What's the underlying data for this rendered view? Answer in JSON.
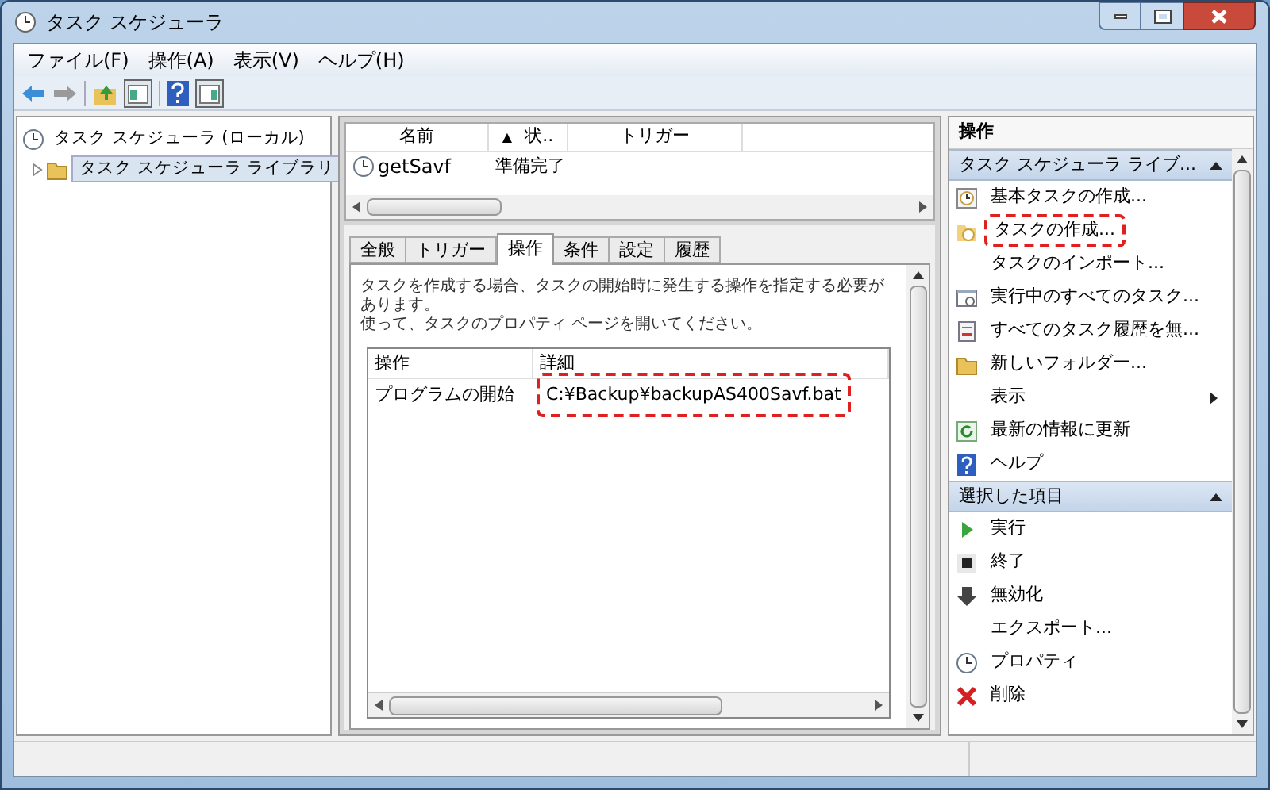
{
  "window": {
    "title": "タスク スケジューラ"
  },
  "menu": [
    "ファイル(F)",
    "操作(A)",
    "表示(V)",
    "ヘルプ(H)"
  ],
  "tree": [
    {
      "label": "タスク スケジューラ (ローカル)",
      "selected": false,
      "kind": "clock",
      "children": [
        {
          "label": "タスク スケジューラ ライブラリ",
          "selected": true,
          "kind": "folder",
          "expanded": false
        }
      ]
    }
  ],
  "task_list": {
    "columns": [
      {
        "label": "名前"
      },
      {
        "label": "状..",
        "sort": "▲"
      },
      {
        "label": "トリガー"
      }
    ],
    "rows": [
      {
        "name": "getSavf",
        "status": "準備完了",
        "selected": false
      }
    ]
  },
  "tabs": [
    {
      "label": "全般",
      "selected": false
    },
    {
      "label": "トリガー",
      "selected": false
    },
    {
      "label": "操作",
      "selected": true
    },
    {
      "label": "条件",
      "selected": false
    },
    {
      "label": "設定",
      "selected": false
    },
    {
      "label": "履歴",
      "selected": false
    }
  ],
  "description": [
    "タスクを作成する場合、タスクの開始時に発生する操作を指定する必要があります。",
    "使って、タスクのプロパティ ページを開いてください。"
  ],
  "actions_table": {
    "columns": [
      "操作",
      "詳細"
    ],
    "rows": [
      {
        "action": "プログラムの開始",
        "detail": "C:¥Backup¥backupAS400Savf.bat",
        "highlighted": true
      }
    ]
  },
  "actions_pane": {
    "title": "操作",
    "sections": [
      {
        "title": "タスク スケジューラ ライブ...",
        "expanded": true,
        "items": [
          {
            "label": "基本タスクの作成...",
            "kind": "wizard",
            "highlighted": false
          },
          {
            "label": "タスクの作成...",
            "kind": "task",
            "highlighted": true
          },
          {
            "label": "タスクのインポート...",
            "kind": "plain",
            "highlighted": false
          },
          {
            "label": "実行中のすべてのタスク...",
            "kind": "window",
            "highlighted": false
          },
          {
            "label": "すべてのタスク履歴を無...",
            "kind": "history",
            "highlighted": false
          },
          {
            "label": "新しいフォルダー...",
            "kind": "folder",
            "highlighted": false
          },
          {
            "label": "表示",
            "kind": "plain",
            "highlighted": false,
            "submenu": true
          },
          {
            "label": "最新の情報に更新",
            "kind": "refresh",
            "highlighted": false
          },
          {
            "label": "ヘルプ",
            "kind": "help",
            "highlighted": false
          }
        ]
      },
      {
        "title": "選択した項目",
        "expanded": true,
        "items": [
          {
            "label": "実行",
            "kind": "run",
            "highlighted": false
          },
          {
            "label": "終了",
            "kind": "stop",
            "highlighted": false
          },
          {
            "label": "無効化",
            "kind": "down",
            "highlighted": false
          },
          {
            "label": "エクスポート...",
            "kind": "plain",
            "highlighted": false
          },
          {
            "label": "プロパティ",
            "kind": "clock",
            "highlighted": false
          },
          {
            "label": "削除",
            "kind": "delete",
            "highlighted": false
          }
        ]
      }
    ]
  }
}
